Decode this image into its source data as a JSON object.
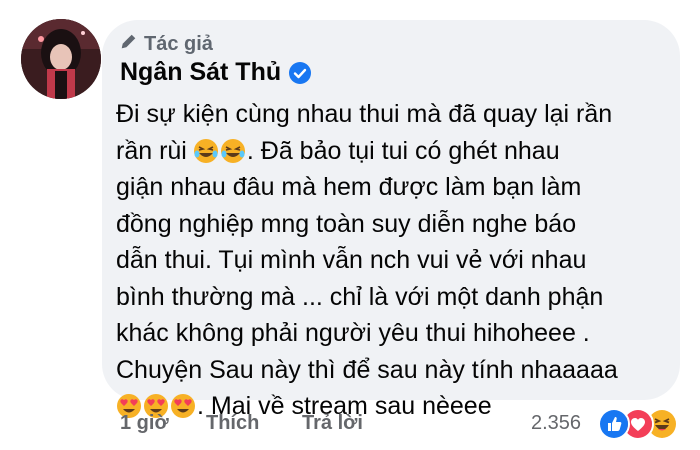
{
  "comment": {
    "author_badge": "Tác giả",
    "author_name": "Ngân Sát Thủ",
    "text_lines": [
      "Đi sự kiện cùng nhau thui mà đã quay lại rần",
      "rần rùi",
      ". Đã bảo tụi tui có ghét nhau",
      "giận nhau đâu mà hem được làm bạn làm",
      "đồng nghiệp mng toàn suy diễn nghe báo",
      "dẫn thui. Tụi mình vẫn nch vui vẻ với nhau",
      "bình thường mà ... chỉ là với một danh phận",
      "khác không phải người yêu thui hihoheee .",
      "Chuyện Sau này thì để sau này tính nhaaaaa",
      ". Mai về stream sau nèeee"
    ],
    "inline_emojis": {
      "line2": [
        "rolling-on-floor-laughing-emoji",
        "rolling-on-floor-laughing-emoji"
      ],
      "line10": [
        "heart-eyes-emoji",
        "heart-eyes-emoji",
        "heart-eyes-emoji"
      ]
    }
  },
  "footer": {
    "time": "1 giờ",
    "like_label": "Thích",
    "reply_label": "Trả lời",
    "reaction_count": "2.356",
    "reactions": [
      "like-icon",
      "love-icon",
      "haha-icon"
    ]
  },
  "colors": {
    "bubble": "#f0f2f5",
    "meta_text": "#65676b",
    "verified": "#1877f2",
    "like": "#1877f2",
    "love": "#f33e58",
    "haha": "#f7b125"
  }
}
